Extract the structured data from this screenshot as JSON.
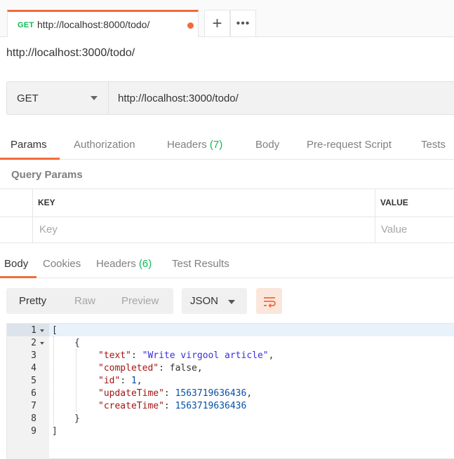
{
  "tab": {
    "method": "GET",
    "title": "http://localhost:8000/todo/",
    "add_label": "+",
    "more_label": "•••"
  },
  "request": {
    "name": "http://localhost:3000/todo/",
    "method": "GET",
    "url": "http://localhost:3000/todo/"
  },
  "request_tabs": [
    {
      "label": "Params"
    },
    {
      "label": "Authorization"
    },
    {
      "label": "Headers",
      "count": "(7)"
    },
    {
      "label": "Body"
    },
    {
      "label": "Pre-request Script"
    },
    {
      "label": "Tests"
    }
  ],
  "query_params": {
    "title": "Query Params",
    "key_header": "KEY",
    "value_header": "VALUE",
    "key_placeholder": "Key",
    "value_placeholder": "Value"
  },
  "response_tabs": [
    {
      "label": "Body"
    },
    {
      "label": "Cookies"
    },
    {
      "label": "Headers",
      "count": "(6)"
    },
    {
      "label": "Test Results"
    }
  ],
  "response_toolbar": {
    "views": [
      "Pretty",
      "Raw",
      "Preview"
    ],
    "format": "JSON"
  },
  "code": {
    "line_numbers": [
      "1",
      "2",
      "3",
      "4",
      "5",
      "6",
      "7",
      "8",
      "9"
    ],
    "open_bracket": "[",
    "open_brace": "{",
    "close_brace": "}",
    "close_bracket": "]",
    "fields": [
      {
        "key": "\"text\"",
        "value": "\"Write virgool article\"",
        "sep": ","
      },
      {
        "key": "\"completed\"",
        "value": "false",
        "sep": ","
      },
      {
        "key": "\"id\"",
        "value": "1",
        "sep": ","
      },
      {
        "key": "\"updateTime\"",
        "value": "1563719636436",
        "sep": ","
      },
      {
        "key": "\"createTime\"",
        "value": "1563719636436",
        "sep": ""
      }
    ]
  },
  "colors": {
    "accent": "#f26b3a",
    "method_green": "#0cbb52"
  }
}
